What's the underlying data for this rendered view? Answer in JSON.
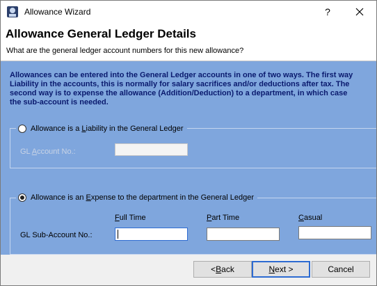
{
  "window": {
    "title": "Allowance Wizard",
    "help": "?"
  },
  "header": {
    "title": "Allowance General Ledger Details",
    "subtitle": "What are the general ledger account numbers for this new allowance?"
  },
  "intro": {
    "line1": "Allowances can be entered into the General Ledger accounts in one of two ways. The first way",
    "line2": "Liability in the accounts, this is normally for salary sacrifices and/or deductions after tax. The",
    "line3": "second way is to expense the allowance (Addition/Deduction) to a department, in which case",
    "line4": "the sub-account is needed."
  },
  "liability": {
    "label_pre": "Allowance is a ",
    "label_accel": "L",
    "label_post": "iability in the General Ledger",
    "checked": false,
    "gl_label_pre": "GL ",
    "gl_label_accel": "A",
    "gl_label_post": "ccount No.:",
    "gl_value": ""
  },
  "expense": {
    "label_pre": "Allowance is an ",
    "label_accel": "E",
    "label_post": "xpense to the department in the General Ledger",
    "checked": true,
    "sub_account_label": "GL Sub-Account No.:",
    "columns": {
      "full_time_accel": "F",
      "full_time_rest": "ull Time",
      "part_time_accel": "P",
      "part_time_rest": "art Time",
      "casual_accel": "C",
      "casual_rest": "asual"
    },
    "values": {
      "full_time": "",
      "part_time": "",
      "casual": ""
    }
  },
  "buttons": {
    "back_pre": "< ",
    "back_accel": "B",
    "back_post": "ack",
    "next_accel": "N",
    "next_post": "ext >",
    "cancel": "Cancel"
  },
  "colors": {
    "panel": "#7fa6dd",
    "intro_text": "#0a1a6e",
    "focus": "#2d6bd1"
  }
}
